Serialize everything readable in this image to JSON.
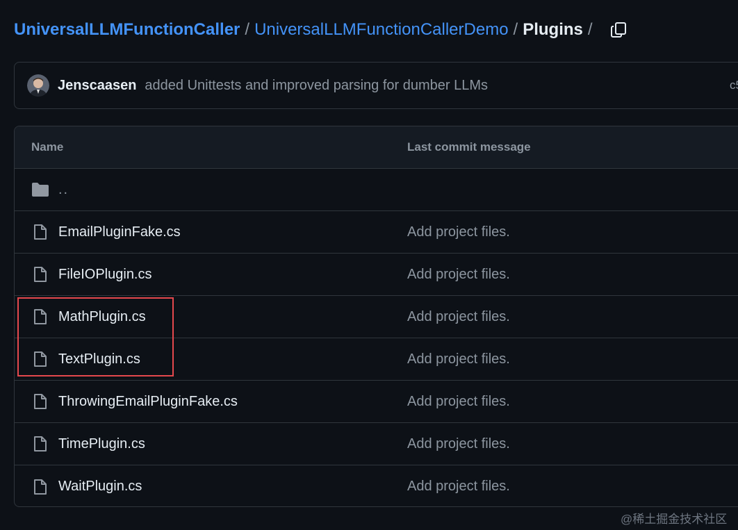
{
  "breadcrumb": {
    "repo": "UniversalLLMFunctionCaller",
    "folder": "UniversalLLMFunctionCallerDemo",
    "current": "Plugins",
    "separator": "/"
  },
  "commit": {
    "author": "Jenscaasen",
    "message": "added Unittests and improved parsing for dumber LLMs",
    "sha_fragment": "c5"
  },
  "table": {
    "headers": {
      "name": "Name",
      "message": "Last commit message"
    },
    "parent_dir": "..",
    "rows": [
      {
        "name": "EmailPluginFake.cs",
        "message": "Add project files."
      },
      {
        "name": "FileIOPlugin.cs",
        "message": "Add project files."
      },
      {
        "name": "MathPlugin.cs",
        "message": "Add project files."
      },
      {
        "name": "TextPlugin.cs",
        "message": "Add project files."
      },
      {
        "name": "ThrowingEmailPluginFake.cs",
        "message": "Add project files."
      },
      {
        "name": "TimePlugin.cs",
        "message": "Add project files."
      },
      {
        "name": "WaitPlugin.cs",
        "message": "Add project files."
      }
    ]
  },
  "icons": {
    "copy": "copy-icon",
    "folder": "folder-icon",
    "file": "file-icon"
  },
  "colors": {
    "background": "#0d1117",
    "link": "#4493f8",
    "border": "#30363d",
    "muted_text": "#8d96a0",
    "highlight": "#e5484d"
  },
  "watermark": "@稀土掘金技术社区"
}
